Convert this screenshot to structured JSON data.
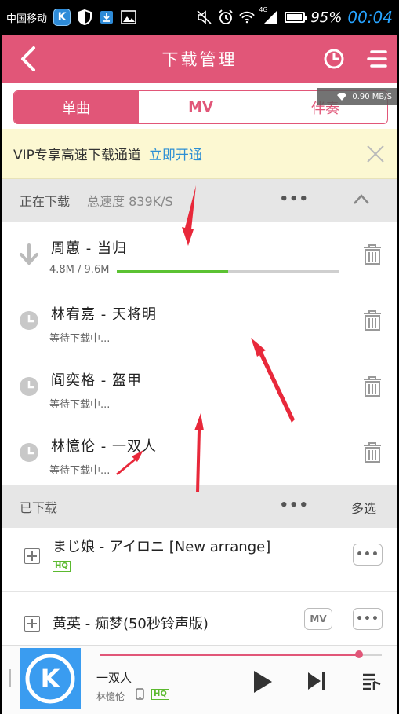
{
  "status_bar": {
    "carrier": "中国移动",
    "kapp_letter": "K",
    "network": "4G",
    "battery_pct": "95%",
    "time": "00:04"
  },
  "header": {
    "title": "下载管理"
  },
  "tabs": [
    {
      "label": "单曲",
      "active": true
    },
    {
      "label": "MV",
      "active": false
    },
    {
      "label": "伴奏",
      "active": false
    }
  ],
  "speed_badge": "0.90 MB/S",
  "vip_banner": {
    "text": "VIP专享高速下载通道",
    "link": "立即开通"
  },
  "downloading": {
    "title": "正在下载",
    "total_speed": "总速度 839K/S",
    "items": [
      {
        "title": "周蕙 - 当归",
        "sub": "4.8M / 9.6M",
        "progress": 0.5
      },
      {
        "title": "林宥嘉 - 天将明",
        "sub": "等待下载中..."
      },
      {
        "title": "阎奕格 - 盔甲",
        "sub": "等待下载中..."
      },
      {
        "title": "林憶伦 - 一双人",
        "sub": "等待下载中..."
      }
    ]
  },
  "downloaded": {
    "title": "已下载",
    "multi_select": "多选",
    "items": [
      {
        "title": "まじ娘 - アイロニ [New arrange]",
        "badge": "HQ"
      },
      {
        "title": "黄英 - 痴梦(50秒铃声版)",
        "mv_label": "MV"
      }
    ]
  },
  "player": {
    "song": "一双人",
    "artist": "林憶伦",
    "quality": "HQ",
    "progress": 0.92,
    "cover_letter": "K"
  },
  "colors": {
    "brand": "#e15678",
    "link": "#2d8fd4",
    "progress_green": "#5bc232",
    "annotation_red": "#e8283a"
  }
}
